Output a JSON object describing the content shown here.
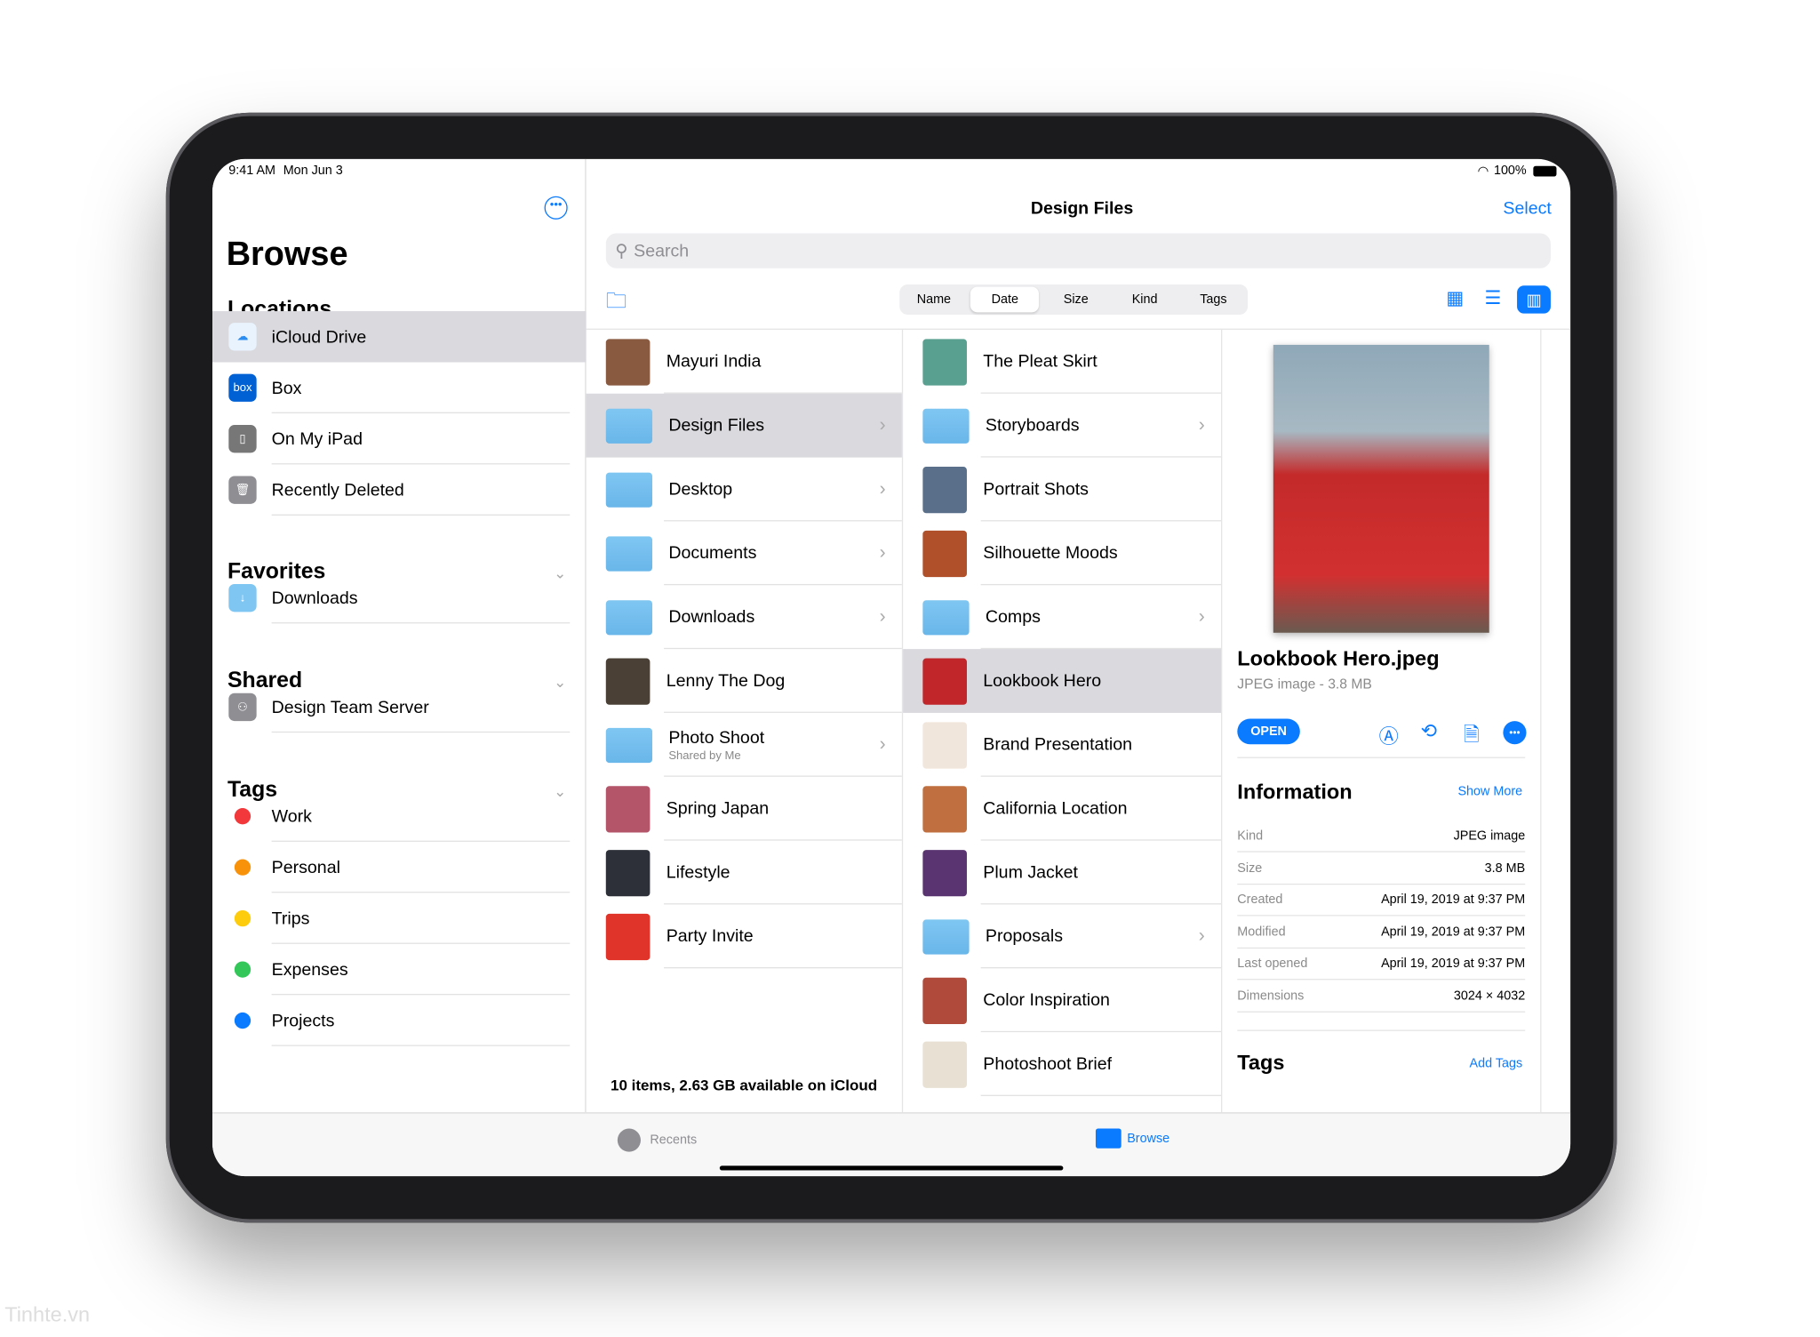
{
  "status_bar": {
    "time": "9:41 AM",
    "date": "Mon Jun 3",
    "battery": "100%"
  },
  "sidebar": {
    "title": "Browse",
    "more_icon": "ellipsis-circle-icon",
    "locations": {
      "header": "Locations",
      "items": [
        {
          "label": "iCloud Drive",
          "icon": "icloud-icon",
          "selected": true
        },
        {
          "label": "Box",
          "icon": "box-icon"
        },
        {
          "label": "On My iPad",
          "icon": "ipad-icon"
        },
        {
          "label": "Recently Deleted",
          "icon": "trash-icon"
        }
      ]
    },
    "favorites": {
      "header": "Favorites",
      "items": [
        {
          "label": "Downloads",
          "icon": "folder-download-icon"
        }
      ]
    },
    "shared": {
      "header": "Shared",
      "items": [
        {
          "label": "Design Team Server",
          "icon": "server-icon"
        }
      ]
    },
    "tags": {
      "header": "Tags",
      "items": [
        {
          "label": "Work",
          "color": "#f2383a"
        },
        {
          "label": "Personal",
          "color": "#f9920b"
        },
        {
          "label": "Trips",
          "color": "#fdcc0d"
        },
        {
          "label": "Expenses",
          "color": "#33c759"
        },
        {
          "label": "Projects",
          "color": "#0a7aff"
        }
      ]
    }
  },
  "header": {
    "title": "Design Files",
    "select": "Select",
    "search_placeholder": "Search",
    "sort": [
      "Name",
      "Date",
      "Size",
      "Kind",
      "Tags"
    ],
    "sort_selected": "Date",
    "view_selected": "columns"
  },
  "column1": {
    "items": [
      {
        "name": "Mayuri India",
        "type": "image",
        "color": "#8a5a40"
      },
      {
        "name": "Design Files",
        "type": "folder",
        "selected": true
      },
      {
        "name": "Desktop",
        "type": "folder"
      },
      {
        "name": "Documents",
        "type": "folder"
      },
      {
        "name": "Downloads",
        "type": "folder"
      },
      {
        "name": "Lenny The Dog",
        "type": "image",
        "color": "#4a4036"
      },
      {
        "name": "Photo Shoot",
        "sub": "Shared by Me",
        "type": "folder"
      },
      {
        "name": "Spring Japan",
        "type": "image",
        "color": "#b4556a"
      },
      {
        "name": "Lifestyle",
        "type": "image",
        "color": "#2d3038"
      },
      {
        "name": "Party Invite",
        "type": "image",
        "color": "#e0342a"
      }
    ],
    "footer": "10 items, 2.63 GB available on iCloud"
  },
  "column2": {
    "items": [
      {
        "name": "The Pleat Skirt",
        "type": "image",
        "color": "#5aa090"
      },
      {
        "name": "Storyboards",
        "type": "folder"
      },
      {
        "name": "Portrait Shots",
        "type": "image",
        "color": "#5a6f8a"
      },
      {
        "name": "Silhouette Moods",
        "type": "image",
        "color": "#b0502a"
      },
      {
        "name": "Comps",
        "type": "folder"
      },
      {
        "name": "Lookbook Hero",
        "type": "image",
        "color": "#c0262a",
        "selected": true
      },
      {
        "name": "Brand Presentation",
        "type": "image",
        "color": "#f1e6dc"
      },
      {
        "name": "California Location",
        "type": "image",
        "color": "#c07040"
      },
      {
        "name": "Plum Jacket",
        "type": "image",
        "color": "#5a3470"
      },
      {
        "name": "Proposals",
        "type": "folder"
      },
      {
        "name": "Color Inspiration",
        "type": "image",
        "color": "#b04a3a"
      },
      {
        "name": "Photoshoot Brief",
        "type": "image",
        "color": "#e8e0d2"
      }
    ]
  },
  "preview": {
    "filename": "Lookbook Hero.jpeg",
    "subtitle": "JPEG image - 3.8 MB",
    "open": "OPEN",
    "actions": [
      "markup-icon",
      "rotate-icon",
      "pdf-icon",
      "more-icon"
    ],
    "info_header": "Information",
    "show_more": "Show More",
    "info": [
      {
        "k": "Kind",
        "v": "JPEG image"
      },
      {
        "k": "Size",
        "v": "3.8 MB"
      },
      {
        "k": "Created",
        "v": "April 19, 2019 at 9:37 PM"
      },
      {
        "k": "Modified",
        "v": "April 19, 2019 at 9:37 PM"
      },
      {
        "k": "Last opened",
        "v": "April 19, 2019 at 9:37 PM"
      },
      {
        "k": "Dimensions",
        "v": "3024 × 4032"
      }
    ],
    "tags_header": "Tags",
    "add_tags": "Add Tags"
  },
  "tabbar": {
    "recents": "Recents",
    "browse": "Browse",
    "selected": "Browse"
  },
  "accent": "#0a7aff",
  "watermark": "Tinhte.vn"
}
